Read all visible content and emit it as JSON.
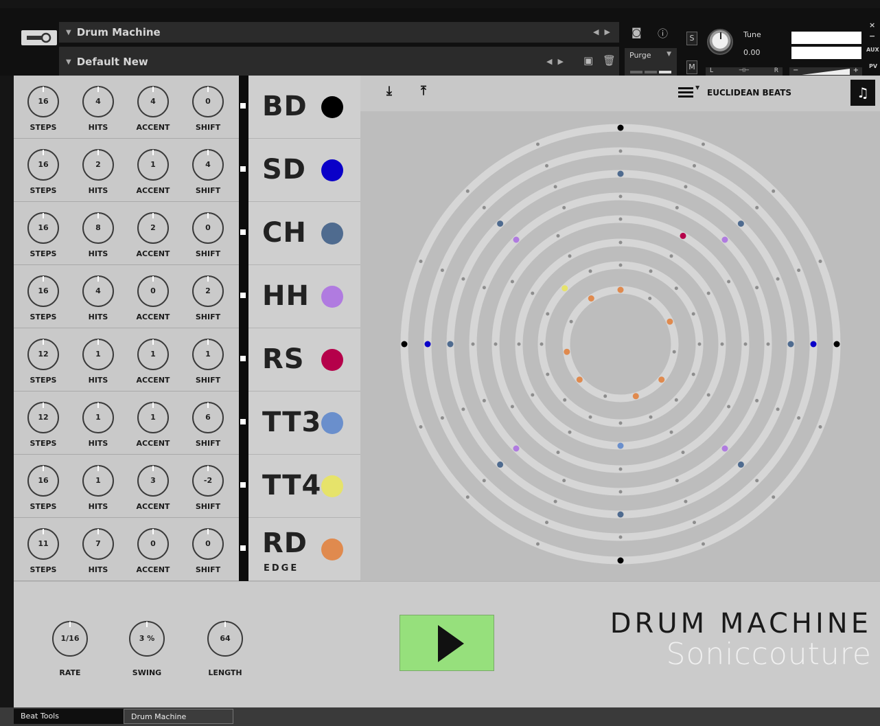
{
  "header": {
    "instrument_name": "Drum Machine",
    "preset_name": "Default New",
    "purge_label": "Purge",
    "tune_label": "Tune",
    "tune_value": "0.00",
    "solo_label": "S",
    "mute_label": "M",
    "pan_left": "L",
    "pan_right": "R",
    "vol_minus": "−",
    "vol_plus": "+",
    "aux_label": "AUX",
    "pv_label": "PV",
    "close_label": "×",
    "min_label": "−"
  },
  "tracks": [
    {
      "name": "BD",
      "sub": "",
      "color": "#000000",
      "steps": "16",
      "hits": "4",
      "accent": "4",
      "shift": "0"
    },
    {
      "name": "SD",
      "sub": "",
      "color": "#0a00c8",
      "steps": "16",
      "hits": "2",
      "accent": "1",
      "shift": "4"
    },
    {
      "name": "CH",
      "sub": "",
      "color": "#4f6b8f",
      "steps": "16",
      "hits": "8",
      "accent": "2",
      "shift": "0"
    },
    {
      "name": "HH",
      "sub": "",
      "color": "#b07be0",
      "steps": "16",
      "hits": "4",
      "accent": "0",
      "shift": "2"
    },
    {
      "name": "RS",
      "sub": "",
      "color": "#b5004a",
      "steps": "12",
      "hits": "1",
      "accent": "1",
      "shift": "1"
    },
    {
      "name": "TT3",
      "sub": "",
      "color": "#6a8fcc",
      "steps": "12",
      "hits": "1",
      "accent": "1",
      "shift": "6"
    },
    {
      "name": "TT4",
      "sub": "",
      "color": "#e6e36a",
      "steps": "16",
      "hits": "1",
      "accent": "3",
      "shift": "-2"
    },
    {
      "name": "RD",
      "sub": "EDGE",
      "color": "#e08a4e",
      "steps": "11",
      "hits": "7",
      "accent": "0",
      "shift": "0"
    }
  ],
  "knob_labels": {
    "steps": "STEPS",
    "hits": "HITS",
    "accent": "ACCENT",
    "shift": "SHIFT"
  },
  "toolbar": {
    "mode_label": "EUCLIDEAN BEATS"
  },
  "global": {
    "rate_value": "1/16",
    "rate_label": "RATE",
    "swing_value": "3 %",
    "swing_label": "SWING",
    "length_value": "64",
    "length_label": "LENGTH"
  },
  "brand": {
    "title": "DRUM MACHINE",
    "maker": "Soniccouture"
  },
  "footer": {
    "tab1": "Beat Tools",
    "tab2": "Drum Machine"
  }
}
